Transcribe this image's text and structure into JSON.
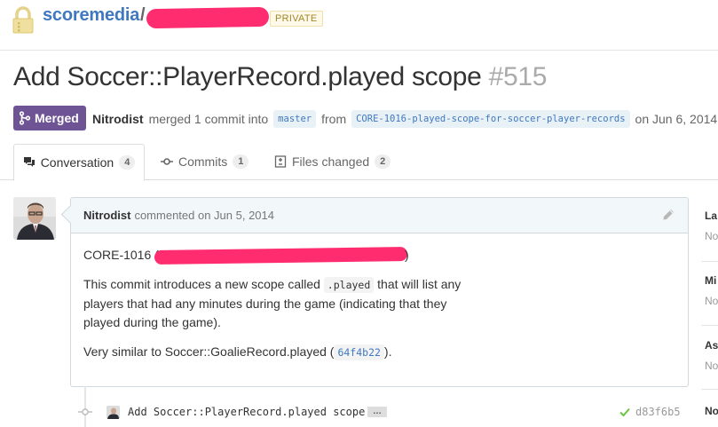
{
  "repo": {
    "owner": "scoremedia",
    "separator": "/",
    "visibility": "PRIVATE"
  },
  "pr": {
    "title": "Add Soccer::PlayerRecord.played scope",
    "number": "#515",
    "state": "Merged",
    "author": "Nitrodist",
    "merged_text": "merged 1 commit into",
    "base_branch": "master",
    "from_text": "from",
    "head_branch": "CORE-1016-played-scope-for-soccer-player-records",
    "date_text": "on Jun 6, 2014"
  },
  "tabs": [
    {
      "label": "Conversation",
      "count": "4",
      "icon": "comment-discussion-icon"
    },
    {
      "label": "Commits",
      "count": "1",
      "icon": "git-commit-icon"
    },
    {
      "label": "Files changed",
      "count": "2",
      "icon": "diff-icon"
    }
  ],
  "comment": {
    "author": "Nitrodist",
    "meta": "commented on Jun 5, 2014",
    "ticket": "CORE-1016 (",
    "ticket_close": ")",
    "body_prefix": "This commit introduces a new scope called",
    "scope_code": ".played",
    "body_suffix": "that will list any players that had any minutes during the game (indicating that they played during the game).",
    "similar_prefix": "Very similar to Soccer::GoalieRecord.played (",
    "similar_sha": "64f4b22",
    "similar_suffix": ")."
  },
  "commit": {
    "message": "Add Soccer::PlayerRecord.played scope",
    "ellipsis": "…",
    "sha": "d83f6b5",
    "status": "success"
  },
  "sidebar": [
    {
      "heading": "La",
      "value": "No"
    },
    {
      "heading": "Mi",
      "value": "No"
    },
    {
      "heading": "As",
      "value": "No"
    },
    {
      "heading": "No",
      "value": ""
    }
  ],
  "colors": {
    "link": "#4078c0",
    "merged": "#6e5494",
    "redaction": "#ff2d6f",
    "success": "#6cc644"
  }
}
